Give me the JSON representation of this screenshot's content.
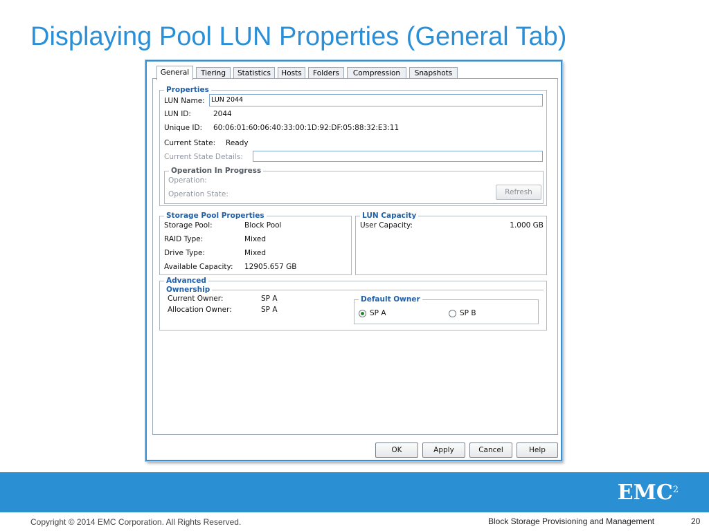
{
  "slide": {
    "title": "Displaying Pool LUN Properties (General Tab)",
    "copyright": "Copyright © 2014 EMC Corporation. All Rights Reserved.",
    "subtitle": "Block Storage Provisioning and Management",
    "page_number": "20",
    "logo": "EMC",
    "logo_sup": "2"
  },
  "tabs": [
    "General",
    "Tiering",
    "Statistics",
    "Hosts",
    "Folders",
    "Compression",
    "Snapshots"
  ],
  "properties": {
    "title": "Properties",
    "lun_name_label": "LUN Name:",
    "lun_name_value": "LUN 2044",
    "lun_id_label": "LUN ID:",
    "lun_id_value": "2044",
    "unique_id_label": "Unique ID:",
    "unique_id_value": "60:06:01:60:06:40:33:00:1D:92:DF:05:88:32:E3:11",
    "current_state_label": "Current State:",
    "current_state_value": "Ready",
    "current_state_details_label": "Current State Details:",
    "current_state_details_value": ""
  },
  "operation": {
    "title": "Operation In Progress",
    "operation_label": "Operation:",
    "operation_state_label": "Operation State:",
    "refresh_button": "Refresh"
  },
  "storage_pool": {
    "title": "Storage Pool Properties",
    "rows": [
      {
        "label": "Storage Pool:",
        "value": "Block Pool"
      },
      {
        "label": "RAID Type:",
        "value": "Mixed"
      },
      {
        "label": "Drive Type:",
        "value": "Mixed"
      },
      {
        "label": "Available Capacity:",
        "value": "12905.657 GB"
      }
    ]
  },
  "lun_capacity": {
    "title": "LUN Capacity",
    "user_capacity_label": "User Capacity:",
    "user_capacity_value": "1.000 GB"
  },
  "advanced": {
    "title": "Advanced",
    "ownership_title": "Ownership",
    "current_owner_label": "Current Owner:",
    "current_owner_value": "SP A",
    "allocation_owner_label": "Allocation Owner:",
    "allocation_owner_value": "SP A",
    "default_owner_title": "Default Owner",
    "option_a": "SP A",
    "option_b": "SP B",
    "selected": "SP A"
  },
  "buttons": {
    "ok": "OK",
    "apply": "Apply",
    "cancel": "Cancel",
    "help": "Help"
  },
  "colors": {
    "accent": "#2a8fd6",
    "footer_bar": "#2b8fd4",
    "group_title": "#1f5fa8"
  }
}
